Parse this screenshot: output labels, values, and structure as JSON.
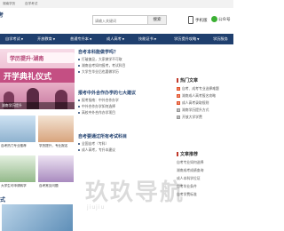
{
  "topbar": {
    "links": [
      "湖南学历",
      "自学考试"
    ]
  },
  "header": {
    "site_name": "考",
    "search_placeholder": "请输入关键词",
    "search_button": "搜索",
    "phone_label": "手机版",
    "wechat_label": "公众号"
  },
  "nav": {
    "items": [
      "自学考试",
      "开放教育",
      "普通专升本",
      "成人高考",
      "技能证书",
      "学历提升攻略",
      "学历服务"
    ]
  },
  "banner": {
    "band_top": "学历提升·湖南",
    "band_main": "开学典礼仪式",
    "caption": "湖南学历提升"
  },
  "tiles": [
    {
      "title": "自考热门专业推荐"
    },
    {
      "title": "学历提升，专业报名"
    },
    {
      "title": "大学生可申请转学"
    },
    {
      "title": "自考常见问题"
    }
  ],
  "news": {
    "blocks": [
      {
        "heading": "自考本科能做学吗？",
        "lines": [
          "打破偏见，大家做学不可取",
          "湖南自考如何报考，考试科目",
          "大学生毕业后也要做学历"
        ]
      },
      {
        "heading": "报考中外合作办学的七大建议",
        "lines": [
          "报考指南：中外合作办学",
          "中外合作办学如何选择",
          "高校中外合作办学项目"
        ]
      },
      {
        "heading": "自考要通过所有考试科目",
        "lines": [
          "全国自考（专科）",
          "成人高考，专升本建议"
        ]
      }
    ]
  },
  "side": {
    "hot_title": "热门文章",
    "hot_items": [
      "自考、成考专业选择难题",
      "湖南成人高考报名攻略",
      "成人高考录取规则",
      "湖南学历提升方式",
      "开放大学学费"
    ],
    "rec_title": "文章推荐",
    "rec_items": [
      "自考专业如何选择",
      "湖南成考成绩查询",
      "成人本科学位证",
      "自考毕业条件",
      "自考学费标准"
    ]
  },
  "bottom": {
    "heading": "式"
  },
  "watermark": {
    "text": "玖玖导航",
    "sub": "jiujiu"
  }
}
